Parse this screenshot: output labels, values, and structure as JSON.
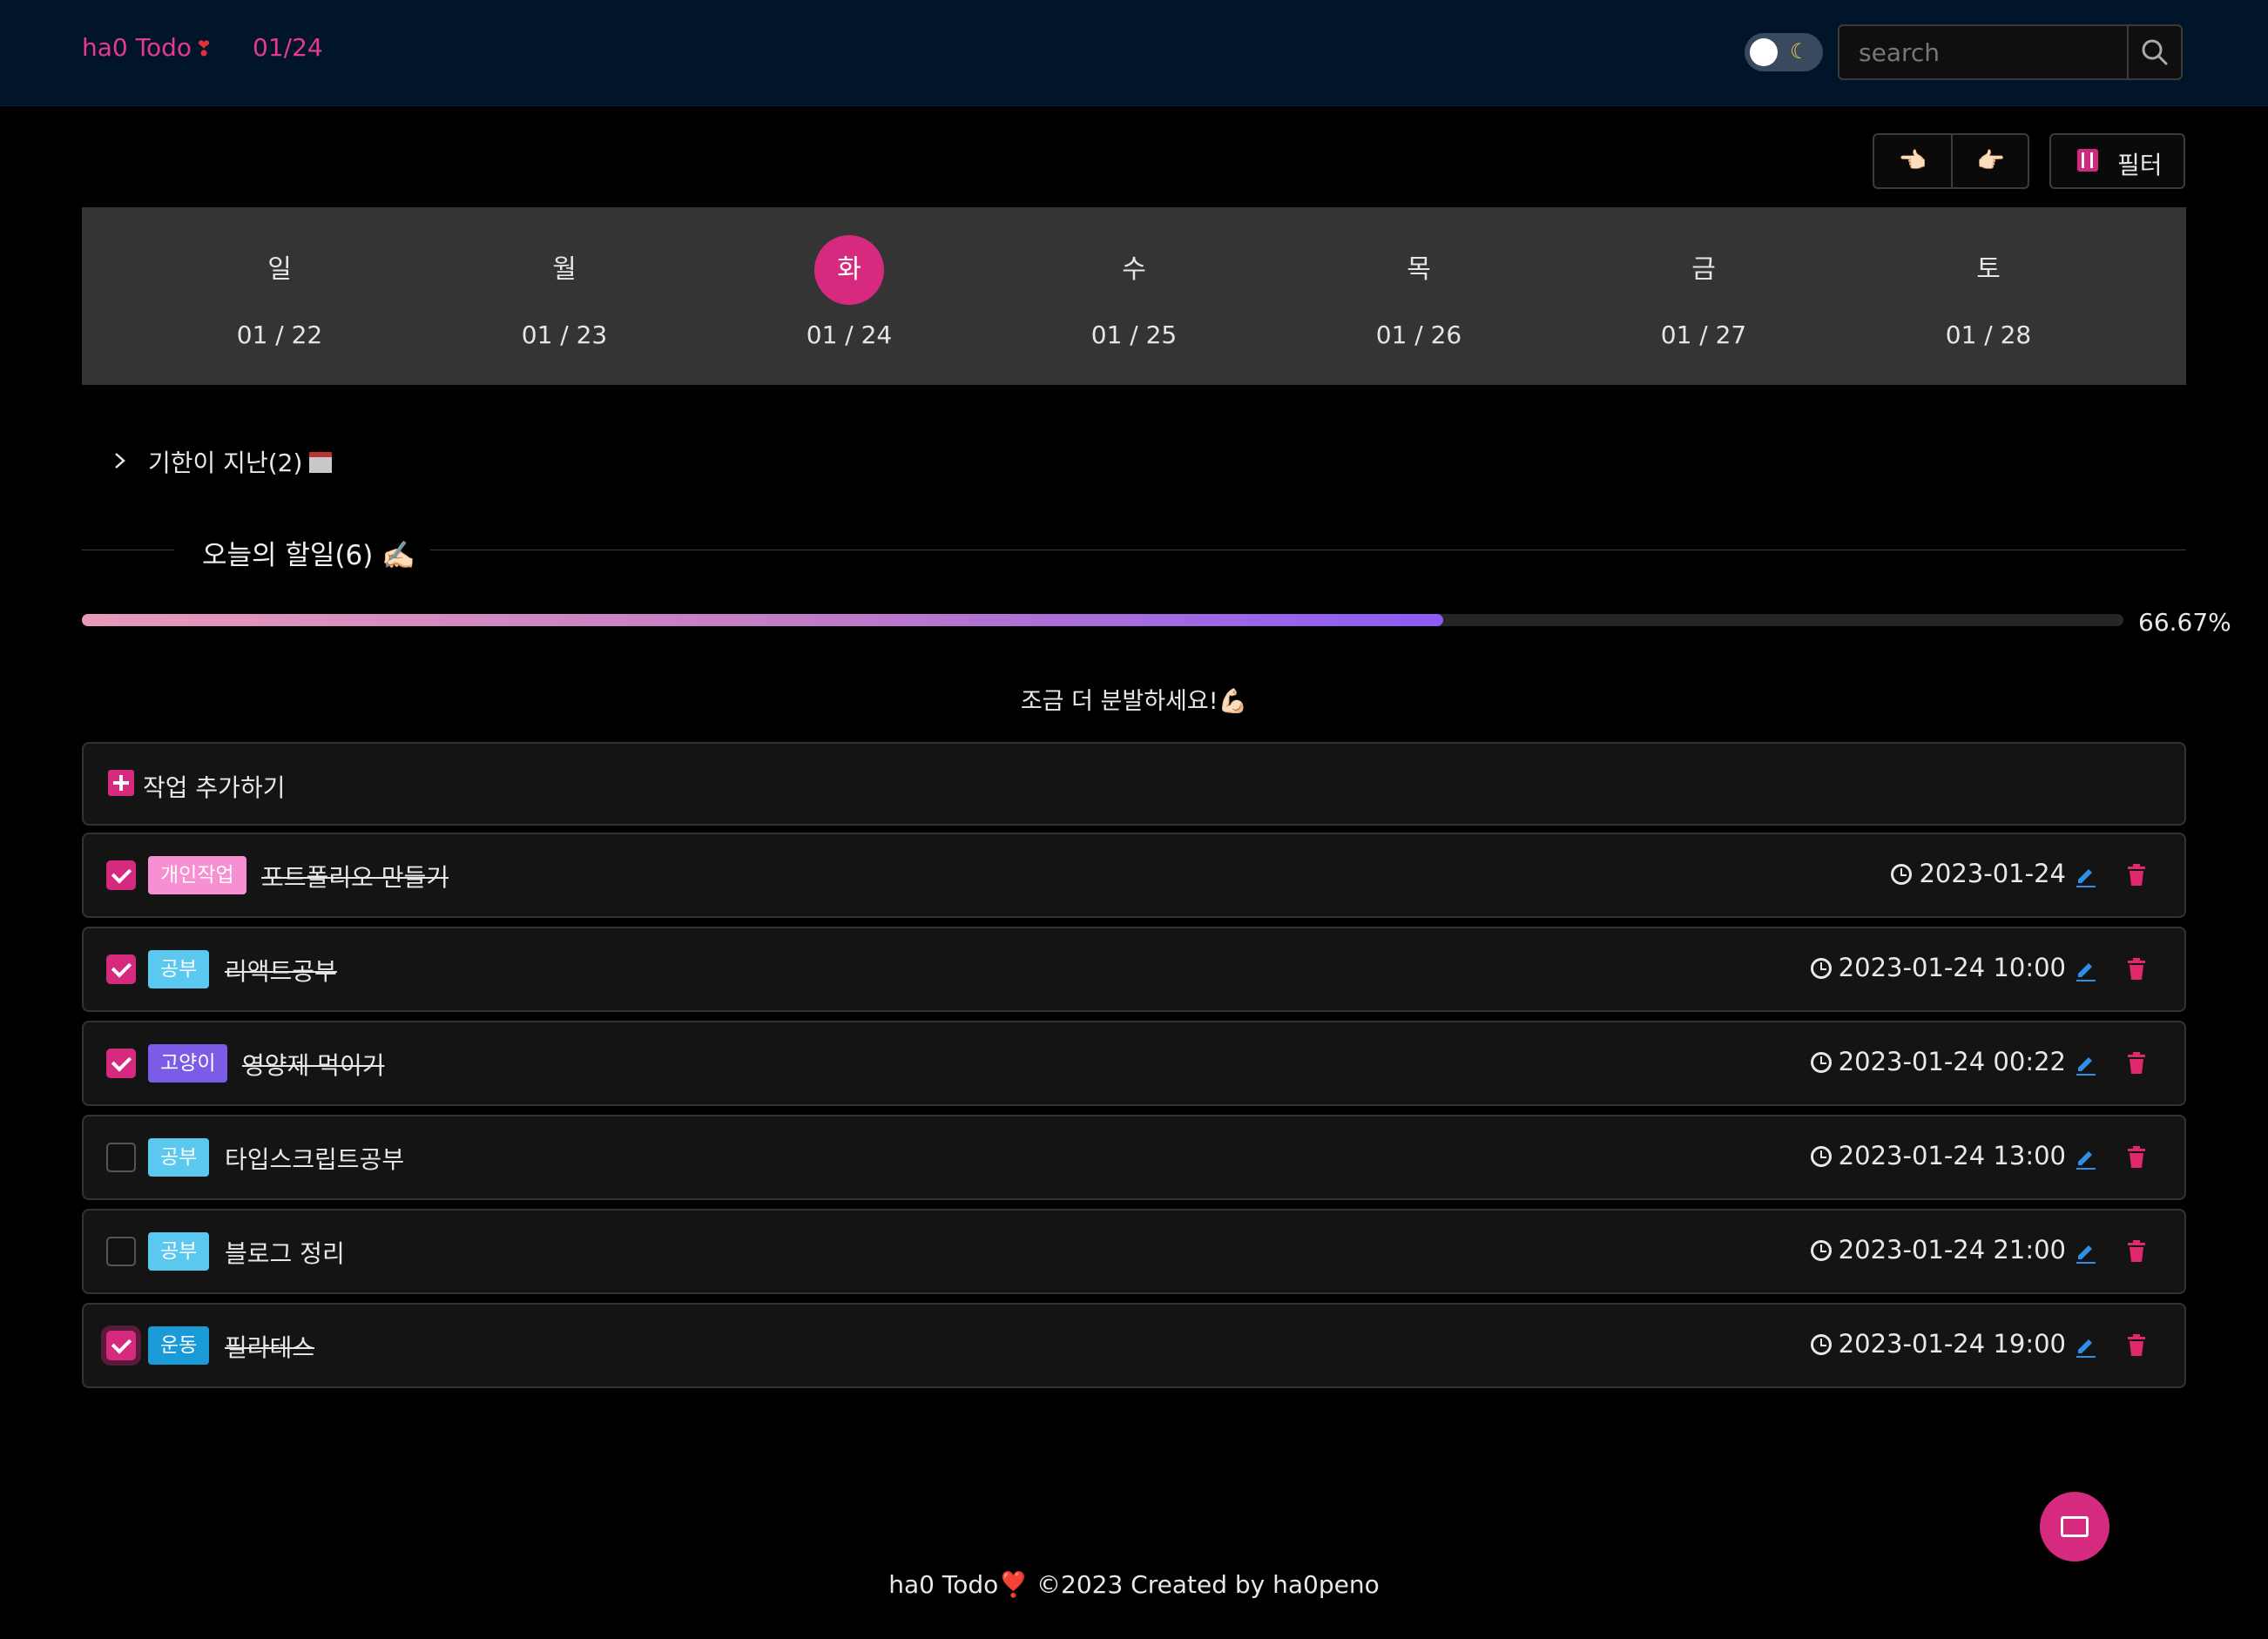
{
  "header": {
    "brand": "ha0 Todo",
    "brand_heart": "❣",
    "current_date": "01/24",
    "theme_toggle_icon": "moon-icon",
    "search_placeholder": "search"
  },
  "toolbar": {
    "prev_week_icon": "👈🏻",
    "next_week_icon": "👉🏻",
    "filter_label": "필터"
  },
  "week": {
    "days": [
      {
        "name": "일",
        "date": "01 / 22",
        "active": false
      },
      {
        "name": "월",
        "date": "01 / 23",
        "active": false
      },
      {
        "name": "화",
        "date": "01 / 24",
        "active": true
      },
      {
        "name": "수",
        "date": "01 / 25",
        "active": false
      },
      {
        "name": "목",
        "date": "01 / 26",
        "active": false
      },
      {
        "name": "금",
        "date": "01 / 27",
        "active": false
      },
      {
        "name": "토",
        "date": "01 / 28",
        "active": false
      }
    ]
  },
  "overdue": {
    "label": "기한이 지난(2)"
  },
  "today": {
    "title": "오늘의 할일(6) ✍🏻",
    "progress_percent": 66.67,
    "progress_label": "66.67%",
    "encourage": "조금 더 분발하세요!💪🏻"
  },
  "add_task": {
    "label": "작업 추가하기"
  },
  "tasks": [
    {
      "tag": "개인작업",
      "tag_color": "#f78fd3",
      "title": "포트폴리오 만들기",
      "due": "2023-01-24",
      "done": true
    },
    {
      "tag": "공부",
      "tag_color": "#5bc8f0",
      "title": "리액트공부",
      "due": "2023-01-24 10:00",
      "done": true
    },
    {
      "tag": "고양이",
      "tag_color": "#7b5ce6",
      "title": "영양제 먹이기",
      "due": "2023-01-24 00:22",
      "done": true
    },
    {
      "tag": "공부",
      "tag_color": "#5bc8f0",
      "title": "타입스크립트공부",
      "due": "2023-01-24 13:00",
      "done": false
    },
    {
      "tag": "공부",
      "tag_color": "#5bc8f0",
      "title": "블로그 정리",
      "due": "2023-01-24 21:00",
      "done": false
    },
    {
      "tag": "운동",
      "tag_color": "#1a9ad6",
      "title": "필라테스",
      "due": "2023-01-24 19:00",
      "done": true
    }
  ],
  "colors": {
    "accent": "#d62a7f",
    "edit_icon": "#2f8fe8",
    "delete_icon": "#e0286f"
  },
  "footer": {
    "text": "ha0 Todo❣️ ©2023 Created by ha0peno"
  }
}
